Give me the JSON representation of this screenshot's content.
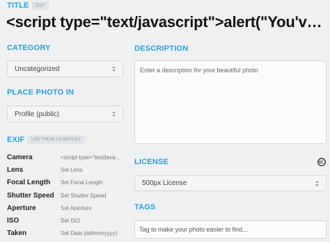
{
  "title": {
    "label": "TITLE",
    "edit_label": "EDIT",
    "value": "<script type=\"text/javascript\">alert(\"You've been hacked\")"
  },
  "category": {
    "label": "CATEGORY",
    "selected": "Uncategorized"
  },
  "place_photo_in": {
    "label": "PLACE PHOTO IN",
    "selected": "Profile (public)"
  },
  "exif": {
    "label": "EXIF",
    "default_button": "USE THESE AS DEFAULT",
    "rows": [
      {
        "label": "Camera",
        "value": "<script type=\"text/javascript\">alert(\"You've been hacked\")"
      },
      {
        "label": "Lens",
        "value": "Set Lens"
      },
      {
        "label": "Focal Length",
        "value": "Set Focal Length"
      },
      {
        "label": "Shutter Speed",
        "value": "Set Shutter Speed"
      },
      {
        "label": "Aperture",
        "value": "Set Aperture"
      },
      {
        "label": "ISO",
        "value": "Set ISO"
      },
      {
        "label": "Taken",
        "value": "Set Date (dd/mm/yyyy)"
      }
    ]
  },
  "description": {
    "label": "DESCRIPTION",
    "placeholder": "Enter a description for your beautiful photo"
  },
  "license": {
    "label": "LICENSE",
    "icon": "creative-commons-icon",
    "selected": "500px License"
  },
  "tags": {
    "label": "TAGS",
    "placeholder": "Tag to make your photo easier to find..."
  },
  "colors": {
    "accent": "#2a9fd6",
    "background": "#eef0f2"
  }
}
